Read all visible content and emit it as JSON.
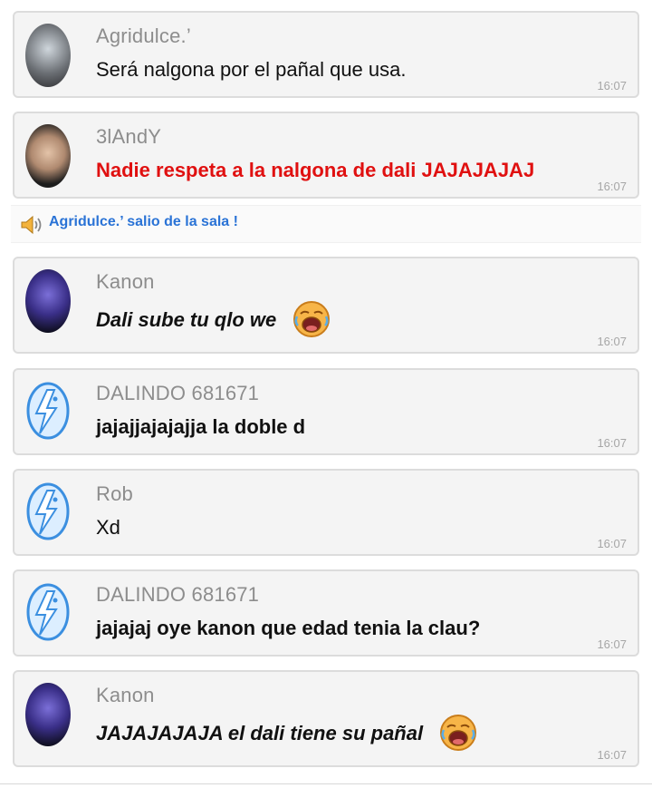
{
  "messages": [
    {
      "user": "Agridulce.’",
      "text": "Será nalgona por el pañal que usa.",
      "time": "16:07",
      "avatar": "photo"
    },
    {
      "user": "3lAndY",
      "text": "Nadie respeta a la nalgona de dali JAJAJAJAJ",
      "time": "16:07",
      "avatar": "face"
    },
    {
      "user": "Kanon",
      "text": "Dali sube tu qlo we",
      "time": "16:07",
      "avatar": "dark",
      "emoji": "laughing-crying-emoji"
    },
    {
      "user": "DALINDO 681671",
      "text": "jajajjajajajja la doble d",
      "time": "16:07",
      "avatar": "default"
    },
    {
      "user": "Rob",
      "text": "Xd",
      "time": "16:07",
      "avatar": "default"
    },
    {
      "user": "DALINDO 681671",
      "text": "jajajaj oye kanon que edad tenia la clau?",
      "time": "16:07",
      "avatar": "default"
    },
    {
      "user": "Kanon",
      "text": "JAJAJAJAJA el dali tiene su pañal",
      "time": "16:07",
      "avatar": "dark",
      "emoji": "laughing-crying-emoji"
    }
  ],
  "system_message": {
    "text": "Agridulce.’ salio de la sala !",
    "icon": "speaker-icon"
  },
  "colors": {
    "red_text": "#e01010",
    "system_blue": "#2a73d6",
    "bubble_bg": "#f4f4f4"
  }
}
